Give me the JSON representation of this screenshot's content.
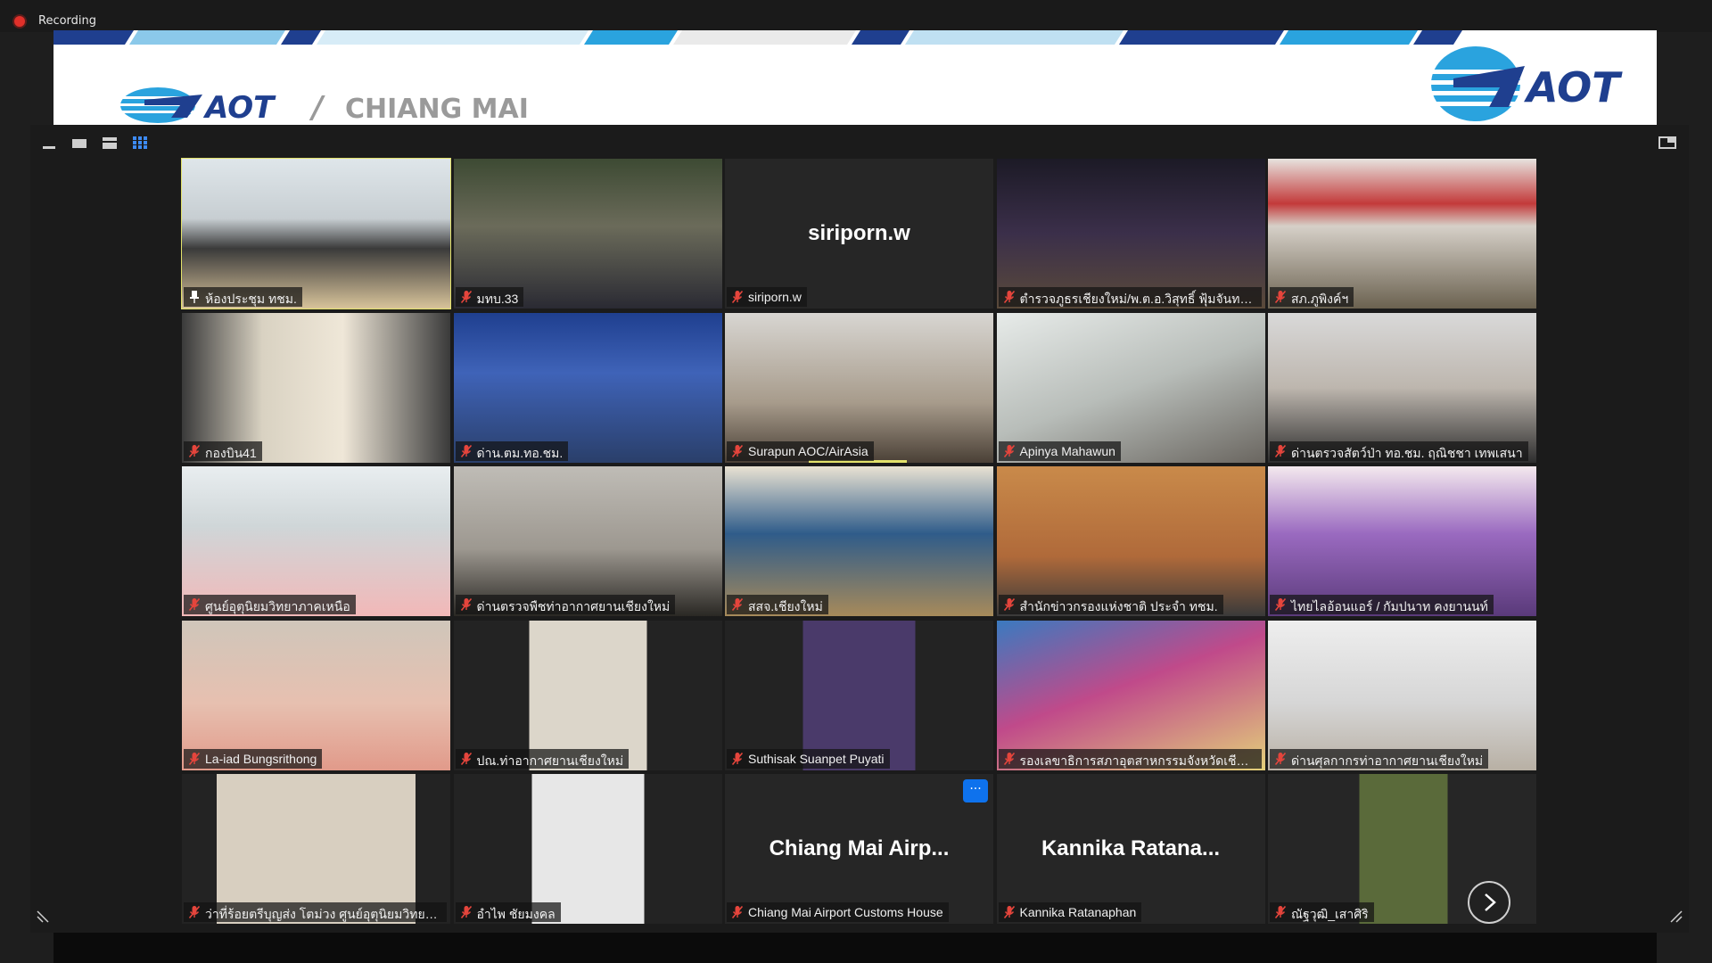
{
  "recording": {
    "label": "Recording"
  },
  "banner": {
    "brand": "AOT",
    "separator": "/",
    "location": "CHIANG MAI",
    "brand_right": "AOT",
    "colors": {
      "navy": "#1f3f8f",
      "sky": "#2aa3de",
      "gray": "#8b8b8b"
    }
  },
  "view_controls": [
    "minimize-icon",
    "thumbnail-icon",
    "speaker-view-icon",
    "gallery-view-icon",
    "exit-fullscreen-icon"
  ],
  "gallery": {
    "participants": [
      {
        "name": "ห้องประชุม ทชม.",
        "video": true,
        "active": true,
        "pin": true
      },
      {
        "name": "มทบ.33",
        "video": true
      },
      {
        "name": "siriporn.w",
        "video": false,
        "display": "siriporn.w"
      },
      {
        "name": "ตำรวจภูธรเชียงใหม่/พ.ต.อ.วิสุทธิ์ ฟุ้มจันทร์ ร...",
        "video": true
      },
      {
        "name": "สภ.ภูพิงค์ฯ",
        "video": true
      },
      {
        "name": "กองบิน41",
        "video": true
      },
      {
        "name": "ด่าน.ตม.ทอ.ชม.",
        "video": true
      },
      {
        "name": "Surapun AOC/AirAsia",
        "video": true,
        "speaking": true
      },
      {
        "name": "Apinya Mahawun",
        "video": true
      },
      {
        "name": "ด่านตรวจสัตว์ป่า ทอ.ชม. ฤณิชชา เทพเสนา",
        "video": true
      },
      {
        "name": "ศูนย์อุตุนิยมวิทยาภาคเหนือ",
        "video": true
      },
      {
        "name": "ด่านตรวจพืชท่าอากาศยานเชียงใหม่",
        "video": true
      },
      {
        "name": "สสจ.เชียงใหม่",
        "video": true
      },
      {
        "name": "สำนักข่าวกรองแห่งชาติ ประจำ ทชม.",
        "video": true
      },
      {
        "name": "ไทยไลอ้อนแอร์ / กัมปนาท คงยานนท์",
        "video": true
      },
      {
        "name": "La-iad Bungsrithong",
        "video": true
      },
      {
        "name": "ปณ.ท่าอากาศยานเชียงใหม่",
        "video": true
      },
      {
        "name": "Suthisak Suanpet Puyati",
        "video": true
      },
      {
        "name": "รองเลขาธิการสภาอุตสาหกรรมจังหวัดเชียงใ...",
        "video": true
      },
      {
        "name": "ด่านศุลกากรท่าอากาศยานเชียงใหม่",
        "video": true
      },
      {
        "name": "ว่าที่ร้อยตรีบุญส่ง โตม่วง ศูนย์อุตุนิยมวิทยาภ...",
        "video": true
      },
      {
        "name": "อำไพ ชัยมงคล",
        "video": true
      },
      {
        "name": "Chiang Mai Airport Customs House",
        "video": false,
        "display": "Chiang Mai Airp...",
        "more": "···"
      },
      {
        "name": "Kannika Ratanaphan",
        "video": false,
        "display": "Kannika  Ratana..."
      },
      {
        "name": "ณัฐวุฒิ_เสาศิริ",
        "video": true
      }
    ]
  }
}
